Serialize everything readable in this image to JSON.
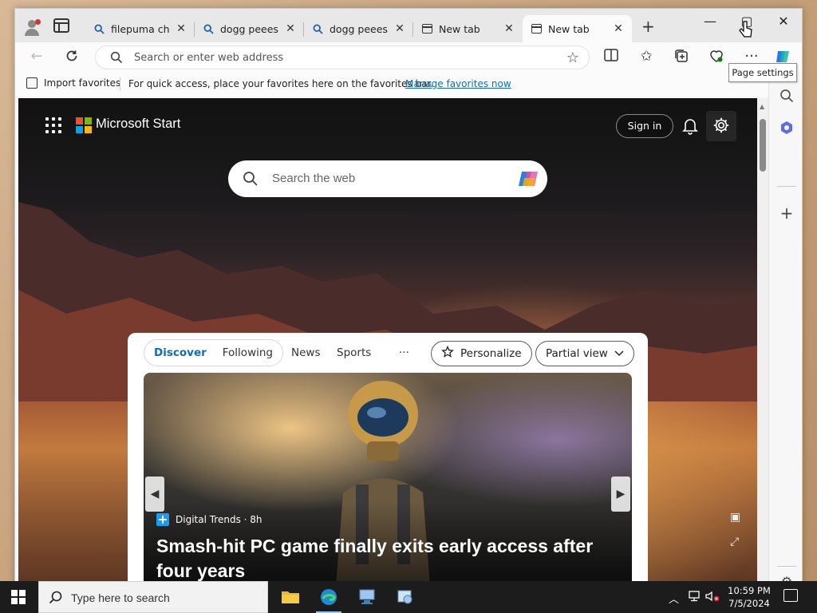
{
  "browser": {
    "tabs": [
      {
        "label": "filepuma chro",
        "icon": "search-icon"
      },
      {
        "label": "dogg peees o",
        "icon": "search-icon"
      },
      {
        "label": "dogg peees o",
        "icon": "search-icon"
      },
      {
        "label": "New tab",
        "icon": "newtab-icon"
      },
      {
        "label": "New tab",
        "icon": "newtab-icon",
        "active": true
      }
    ],
    "new_tab_glyph": "+",
    "window_buttons": {
      "minimize": "—",
      "maximize": "▢",
      "close": "✕"
    }
  },
  "toolbar": {
    "address_placeholder": "Search or enter web address",
    "star_glyph": "☆"
  },
  "favorites_bar": {
    "import": "Import favorites",
    "message": "For quick access, place your favorites here on the favorites bar.",
    "manage": "Manage favorites now"
  },
  "page": {
    "brand": "Microsoft Start",
    "sign_in": "Sign in",
    "tooltip": "Page settings",
    "search_placeholder": "Search the web",
    "feed": {
      "pivot_tabs": [
        "Discover",
        "Following"
      ],
      "nav": [
        "News",
        "Sports"
      ],
      "more": "···",
      "personalize": "Personalize",
      "view": "Partial view",
      "source": "Digital Trends · 8h",
      "headline": "Smash-hit PC game finally exits early access after four years"
    }
  },
  "taskbar": {
    "search_placeholder": "Type here to search",
    "time": "10:59 PM",
    "date": "7/5/2024"
  },
  "colors": {
    "accent": "#0f6cbd",
    "ms_red": "#f25022",
    "ms_green": "#7fba00",
    "ms_blue": "#00a4ef",
    "ms_yellow": "#ffb900"
  }
}
